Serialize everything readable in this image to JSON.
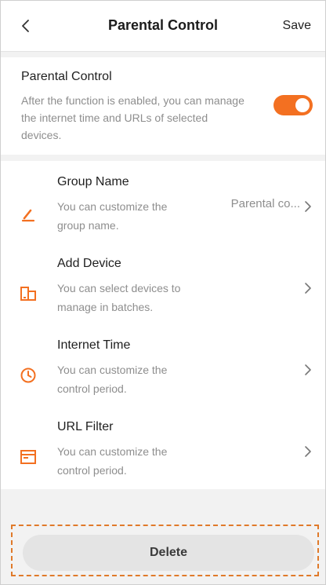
{
  "header": {
    "title": "Parental Control",
    "save_label": "Save",
    "back_icon": "chevron-left-icon"
  },
  "toggle": {
    "title": "Parental Control",
    "description": "After the function is enabled, you can manage the internet time and URLs of selected devices.",
    "enabled": true,
    "color": "#f37021"
  },
  "items": [
    {
      "title": "Group Name",
      "description": "You can customize the group name.",
      "value": "Parental co...",
      "icon": "pencil-icon"
    },
    {
      "title": "Add Device",
      "description": "You can select devices to manage in batches.",
      "value": "",
      "icon": "devices-icon"
    },
    {
      "title": "Internet Time",
      "description": "You can customize the control period.",
      "value": "",
      "icon": "clock-icon"
    },
    {
      "title": "URL Filter",
      "description": "You can customize the control period.",
      "value": "",
      "icon": "browser-icon"
    }
  ],
  "delete_label": "Delete",
  "colors": {
    "accent": "#f37021",
    "highlight_border": "#e07a2a"
  }
}
